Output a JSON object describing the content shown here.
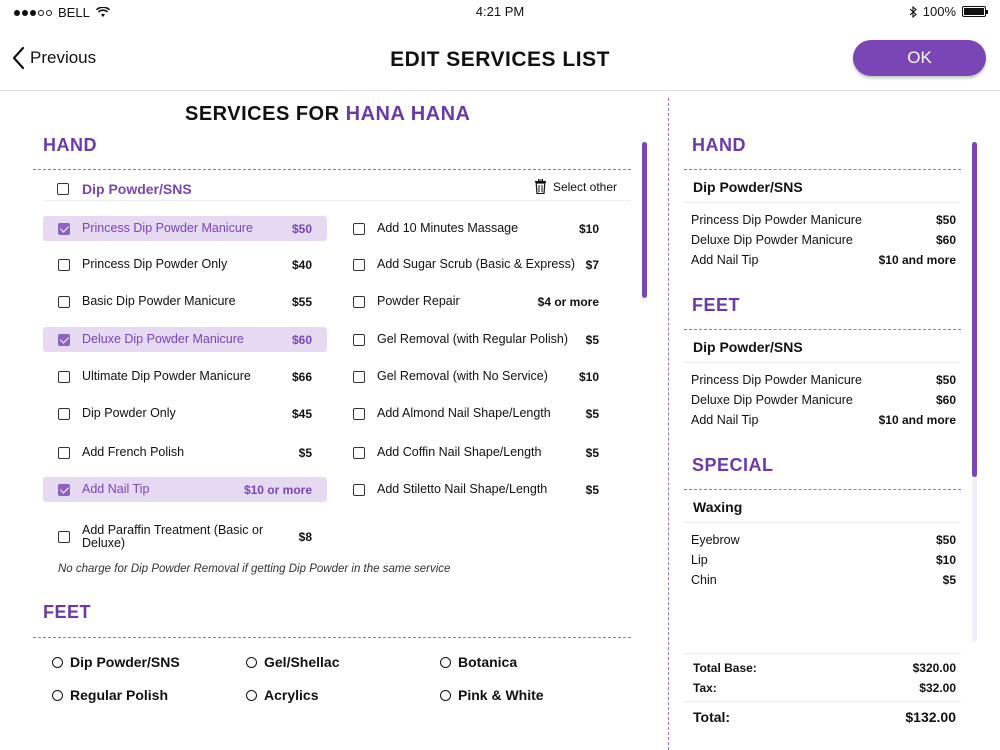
{
  "status": {
    "carrier": "BELL",
    "time": "4:21 PM",
    "battery": "100%"
  },
  "nav": {
    "back_label": "Previous",
    "title": "EDIT SERVICES LIST",
    "ok_label": "OK"
  },
  "left": {
    "title_prefix": "SERVICES FOR ",
    "client": "HANA HANA",
    "hand_heading": "HAND",
    "category": "Dip Powder/SNS",
    "select_other": "Select other",
    "col1": [
      {
        "name": "Princess Dip Powder Manicure",
        "price": "$50",
        "checked": true
      },
      {
        "name": "Princess Dip Powder Only",
        "price": "$40",
        "checked": false
      },
      {
        "name": "Basic Dip Powder Manicure",
        "price": "$55",
        "checked": false
      },
      {
        "name": " Deluxe Dip Powder Manicure",
        "price": "$60",
        "checked": true
      },
      {
        "name": "Ultimate Dip Powder Manicure",
        "price": "$66",
        "checked": false
      },
      {
        "name": "Dip Powder Only",
        "price": "$45",
        "checked": false
      },
      {
        "name": "Add French Polish",
        "price": "$5",
        "checked": false
      },
      {
        "name": "Add Nail Tip",
        "price": "$10 or more",
        "checked": true
      },
      {
        "name": "Add Paraffin Treatment (Basic or Deluxe)",
        "price": "$8",
        "checked": false
      }
    ],
    "col2": [
      {
        "name": "Add 10 Minutes Massage",
        "price": "$10",
        "checked": false
      },
      {
        "name": "Add Sugar Scrub (Basic & Express)",
        "price": "$7",
        "checked": false
      },
      {
        "name": "Powder Repair",
        "price": "$4 or more",
        "checked": false
      },
      {
        "name": "Gel Removal (with Regular Polish)",
        "price": "$5",
        "checked": false
      },
      {
        "name": "Gel Removal (with No Service)",
        "price": "$10",
        "checked": false
      },
      {
        "name": "Add Almond Nail Shape/Length",
        "price": "$5",
        "checked": false
      },
      {
        "name": "Add Coffin Nail Shape/Length",
        "price": "$5",
        "checked": false
      },
      {
        "name": "Add Stiletto Nail Shape/Length",
        "price": "$5",
        "checked": false
      }
    ],
    "note": "No charge for Dip Powder Removal if getting Dip Powder in the same service",
    "feet_heading": "FEET",
    "feet_options": [
      "Dip Powder/SNS",
      "Gel/Shellac",
      "Botanica",
      "Regular Polish",
      "Acrylics",
      "Pink & White"
    ]
  },
  "right": {
    "hand_heading": "HAND",
    "hand_category": "Dip Powder/SNS",
    "hand_items": [
      {
        "name": "Princess Dip Powder Manicure",
        "price": "$50"
      },
      {
        "name": "Deluxe Dip Powder Manicure",
        "price": "$60"
      },
      {
        "name": "Add Nail Tip",
        "price": "$10 and more"
      }
    ],
    "feet_heading": "FEET",
    "feet_category": "Dip Powder/SNS",
    "feet_items": [
      {
        "name": "Princess Dip Powder Manicure",
        "price": "$50"
      },
      {
        "name": "Deluxe Dip Powder Manicure",
        "price": "$60"
      },
      {
        "name": "Add Nail Tip",
        "price": "$10 and more"
      }
    ],
    "special_heading": "SPECIAL",
    "special_category": "Waxing",
    "special_items": [
      {
        "name": "Eyebrow",
        "price": "$50"
      },
      {
        "name": "Lip",
        "price": "$10"
      },
      {
        "name": "Chin",
        "price": "$5"
      }
    ],
    "totals": {
      "base_label": "Total Base:",
      "base_value": "$320.00",
      "tax_label": "Tax:",
      "tax_value": "$32.00",
      "total_label": "Total:",
      "total_value": "$132.00"
    }
  },
  "colors": {
    "accent": "#7a45b5",
    "selected_bg": "#e6d9f2"
  }
}
